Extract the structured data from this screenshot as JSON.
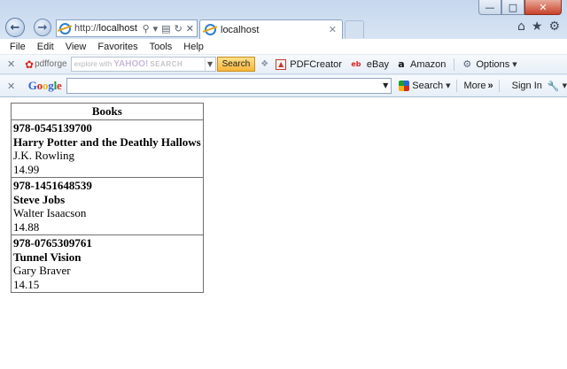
{
  "browser": {
    "address": {
      "url_prefix": "http://",
      "url_host": "localhost",
      "icons": [
        "search-icon",
        "dropdown-icon",
        "compatibility-icon",
        "refresh-icon",
        "stop-icon"
      ]
    },
    "tab": {
      "title": "localhost"
    },
    "window_buttons": [
      "minimize-icon",
      "maximize-icon",
      "close-icon"
    ],
    "right_tools": [
      "home-icon",
      "favorites-star-icon",
      "tools-gear-icon"
    ]
  },
  "menu": {
    "items": [
      "File",
      "Edit",
      "View",
      "Favorites",
      "Tools",
      "Help"
    ]
  },
  "toolbar_pdfforge": {
    "brand": "pdfforge",
    "search_placeholder": "explore with",
    "search_brand": "YAHOO!",
    "search_word": "SEARCH",
    "search_button": "Search",
    "links": [
      "PDFCreator",
      "eBay",
      "Amazon"
    ],
    "options": "Options"
  },
  "toolbar_google": {
    "logo": [
      "G",
      "o",
      "o",
      "g",
      "l",
      "e"
    ],
    "search_button": "Search",
    "more": "More",
    "more_arrows": "»",
    "sign_in": "Sign In"
  },
  "page": {
    "table_header": "Books",
    "books": [
      {
        "isbn": "978-0545139700",
        "title": "Harry Potter and the Deathly Hallows",
        "author": "J.K. Rowling",
        "price": "14.99"
      },
      {
        "isbn": "978-1451648539",
        "title": "Steve Jobs",
        "author": "Walter Isaacson",
        "price": "14.88"
      },
      {
        "isbn": "978-0765309761",
        "title": "Tunnel Vision",
        "author": "Gary Braver",
        "price": "14.15"
      }
    ]
  },
  "colors": {
    "chrome_bg": "#dde8f5",
    "close_button": "#c8422a",
    "table_border": "#707070",
    "yahoo_search_button": "#f7b53a"
  }
}
